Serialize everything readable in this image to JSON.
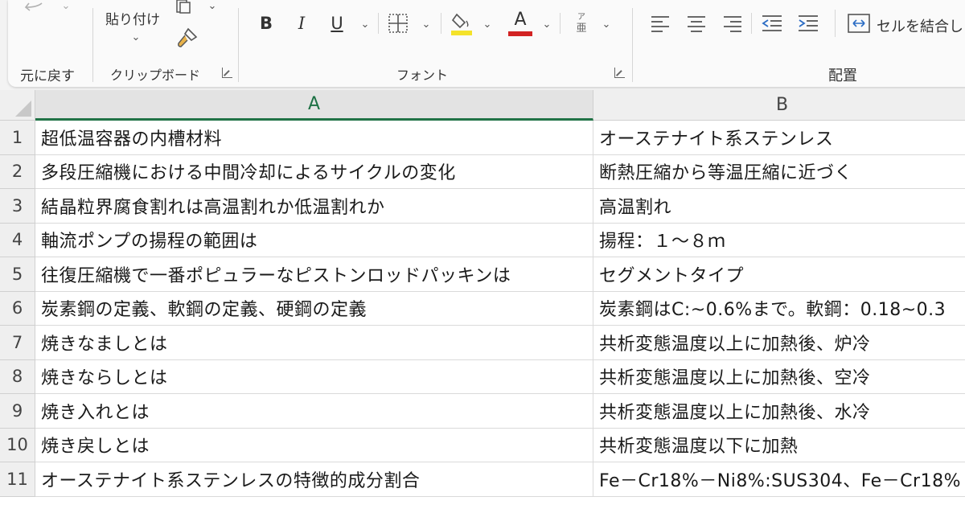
{
  "ribbon": {
    "undo_group_label": "元に戻す",
    "clipboard": {
      "paste_label": "貼り付け",
      "group_label": "クリップボード"
    },
    "font": {
      "bold": "B",
      "italic": "I",
      "underline": "U",
      "font_color_letter": "A",
      "phonetic_top": "ア",
      "phonetic_bottom": "亜",
      "group_label": "フォント",
      "highlight_color": "#f4e22a",
      "font_color": "#d22323"
    },
    "alignment": {
      "merge_label": "セルを結合し",
      "group_label": "配置"
    }
  },
  "sheet": {
    "columns": [
      "A",
      "B"
    ],
    "selected_column": "A",
    "rows": [
      {
        "num": "1",
        "a": "超低温容器の内槽材料",
        "b": "オーステナイト系ステンレス"
      },
      {
        "num": "2",
        "a": "多段圧縮機における中間冷却によるサイクルの変化",
        "b": "断熱圧縮から等温圧縮に近づく"
      },
      {
        "num": "3",
        "a": "結晶粒界腐食割れは高温割れか低温割れか",
        "b": "高温割れ"
      },
      {
        "num": "4",
        "a": "軸流ポンプの揚程の範囲は",
        "b": "揚程：１～８ｍ"
      },
      {
        "num": "5",
        "a": "往復圧縮機で一番ポピュラーなピストンロッドパッキンは",
        "b": "セグメントタイプ"
      },
      {
        "num": "6",
        "a": "炭素鋼の定義、軟鋼の定義、硬鋼の定義",
        "b": "炭素鋼はC:~0.6%まで。軟鋼：0.18~0.3"
      },
      {
        "num": "7",
        "a": "焼きなましとは",
        "b": "共析変態温度以上に加熱後、炉冷"
      },
      {
        "num": "8",
        "a": "焼きならしとは",
        "b": "共析変態温度以上に加熱後、空冷"
      },
      {
        "num": "9",
        "a": "焼き入れとは",
        "b": "共析変態温度以上に加熱後、水冷"
      },
      {
        "num": "10",
        "a": "焼き戻しとは",
        "b": "共析変態温度以下に加熱"
      },
      {
        "num": "11",
        "a": "オーステナイト系ステンレスの特徴的成分割合",
        "b": "Fe－Cr18%－Ni8%:SUS304、Fe－Cr18%"
      }
    ]
  }
}
